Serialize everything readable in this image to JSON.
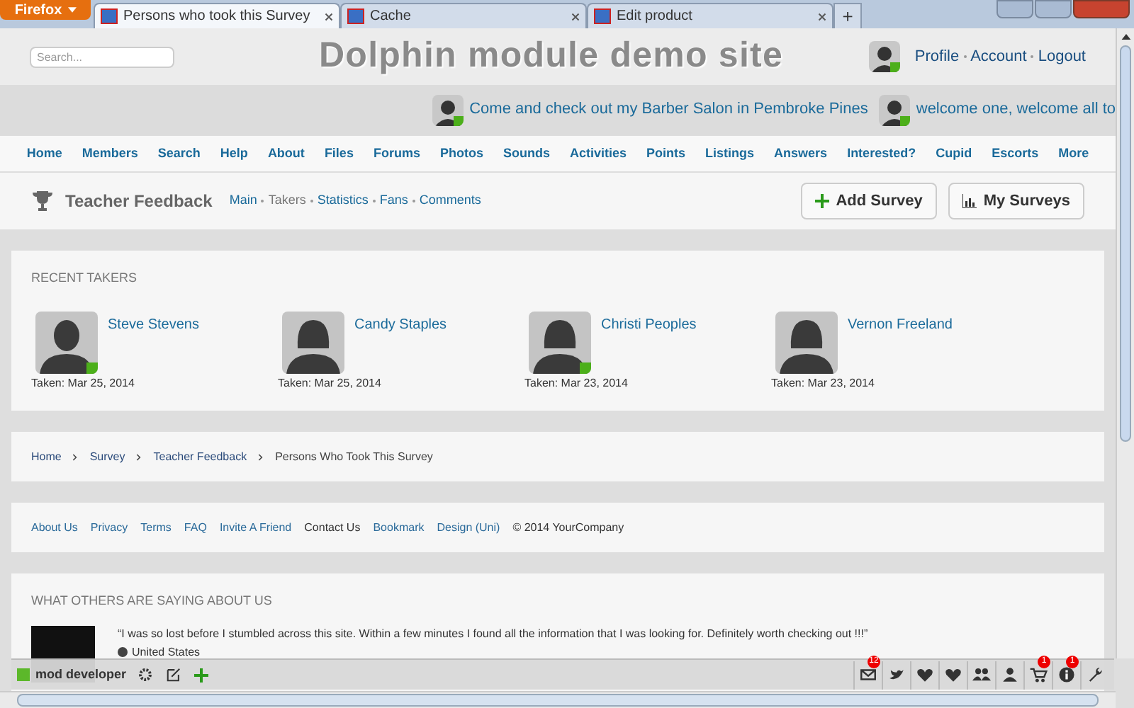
{
  "browser": {
    "menu_button": "Firefox",
    "tabs": [
      {
        "title": "Persons who took this Survey",
        "selected": true
      },
      {
        "title": "Cache",
        "selected": false
      },
      {
        "title": "Edit product",
        "selected": false
      }
    ],
    "new_tab": "+"
  },
  "header": {
    "search": {
      "placeholder": "Search..."
    },
    "site_title": "Dolphin module demo site",
    "user_links": [
      "Profile",
      "Account",
      "Logout"
    ]
  },
  "member_strip": [
    "Come and check out my Barber Salon in Pembroke Pines",
    "welcome one, welcome all to"
  ],
  "nav": [
    "Home",
    "Members",
    "Search",
    "Help",
    "About",
    "Files",
    "Forums",
    "Photos",
    "Sounds",
    "Activities",
    "Points",
    "Listings",
    "Answers",
    "Interested?",
    "Cupid",
    "Escorts",
    "More"
  ],
  "page_bar": {
    "title": "Teacher Feedback",
    "submenu": [
      {
        "label": "Main",
        "selected": false
      },
      {
        "label": "Takers",
        "selected": true
      },
      {
        "label": "Statistics",
        "selected": false
      },
      {
        "label": "Fans",
        "selected": false
      },
      {
        "label": "Comments",
        "selected": false
      }
    ],
    "buttons": [
      {
        "kind": "add",
        "label": "Add Survey"
      },
      {
        "kind": "chart",
        "label": "My Surveys"
      }
    ]
  },
  "recent_takers": {
    "heading": "RECENT TAKERS",
    "takers": [
      {
        "name": "Steve Stevens",
        "taken": "Taken: Mar 25, 2014",
        "online": true,
        "kind": "male"
      },
      {
        "name": "Candy Staples",
        "taken": "Taken: Mar 25, 2014",
        "online": false,
        "kind": "female"
      },
      {
        "name": "Christi Peoples",
        "taken": "Taken: Mar 23, 2014",
        "online": true,
        "kind": "female"
      },
      {
        "name": "Vernon Freeland",
        "taken": "Taken: Mar 23, 2014",
        "online": false,
        "kind": "female"
      }
    ]
  },
  "breadcrumb": [
    "Home",
    "Survey",
    "Teacher Feedback",
    "Persons Who Took This Survey"
  ],
  "footer": {
    "links": [
      {
        "label": "About Us",
        "kind": "link"
      },
      {
        "label": "Privacy",
        "kind": "link"
      },
      {
        "label": "Terms",
        "kind": "link"
      },
      {
        "label": "FAQ",
        "kind": "link"
      },
      {
        "label": "Invite A Friend",
        "kind": "link"
      },
      {
        "label": "Contact Us",
        "kind": "plain"
      },
      {
        "label": "Bookmark",
        "kind": "link"
      },
      {
        "label": "Design (Uni)",
        "kind": "link"
      }
    ],
    "copyright": "© 2014 YourCompany"
  },
  "testimonials": {
    "heading": "WHAT OTHERS ARE SAYING ABOUT US",
    "quote": "“I was so lost before I stumbled across this site. Within a few minutes I found all the information that I was looking for. Definitely worth checking out !!!”",
    "location": "United States"
  },
  "toolbar": {
    "user": "mod developer",
    "icons": [
      {
        "kind": "mail",
        "badge": "12"
      },
      {
        "kind": "bird"
      },
      {
        "kind": "heart"
      },
      {
        "kind": "heart"
      },
      {
        "kind": "group"
      },
      {
        "kind": "person"
      },
      {
        "kind": "cart",
        "badge": "1"
      },
      {
        "kind": "info",
        "badge": "1"
      },
      {
        "kind": "wrench"
      }
    ]
  }
}
